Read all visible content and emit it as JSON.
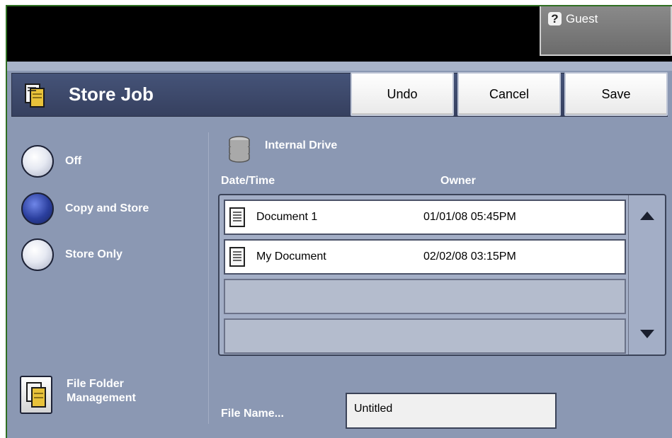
{
  "top_bar": {
    "user_label": "Guest"
  },
  "header": {
    "title": "Store Job",
    "buttons": {
      "undo": "Undo",
      "cancel": "Cancel",
      "save": "Save"
    }
  },
  "options": [
    {
      "label": "Off",
      "selected": false
    },
    {
      "label": "Copy and Store",
      "selected": true
    },
    {
      "label": "Store Only",
      "selected": false
    }
  ],
  "file_folder": {
    "label_line1": "File Folder",
    "label_line2": "Management"
  },
  "drive": {
    "label": "Internal Drive"
  },
  "table": {
    "columns": [
      "Date/Time",
      "Owner"
    ],
    "rows": [
      {
        "name": "Document 1",
        "date": "01/01/08 05:45PM"
      },
      {
        "name": "My Document",
        "date": "02/02/08 03:15PM"
      }
    ]
  },
  "file_name": {
    "label": "File Name...",
    "value": "Untitled"
  },
  "colors": {
    "panel": "#8b98b3",
    "header": "#3c4768",
    "selected_radio": "#2b3f9e"
  }
}
